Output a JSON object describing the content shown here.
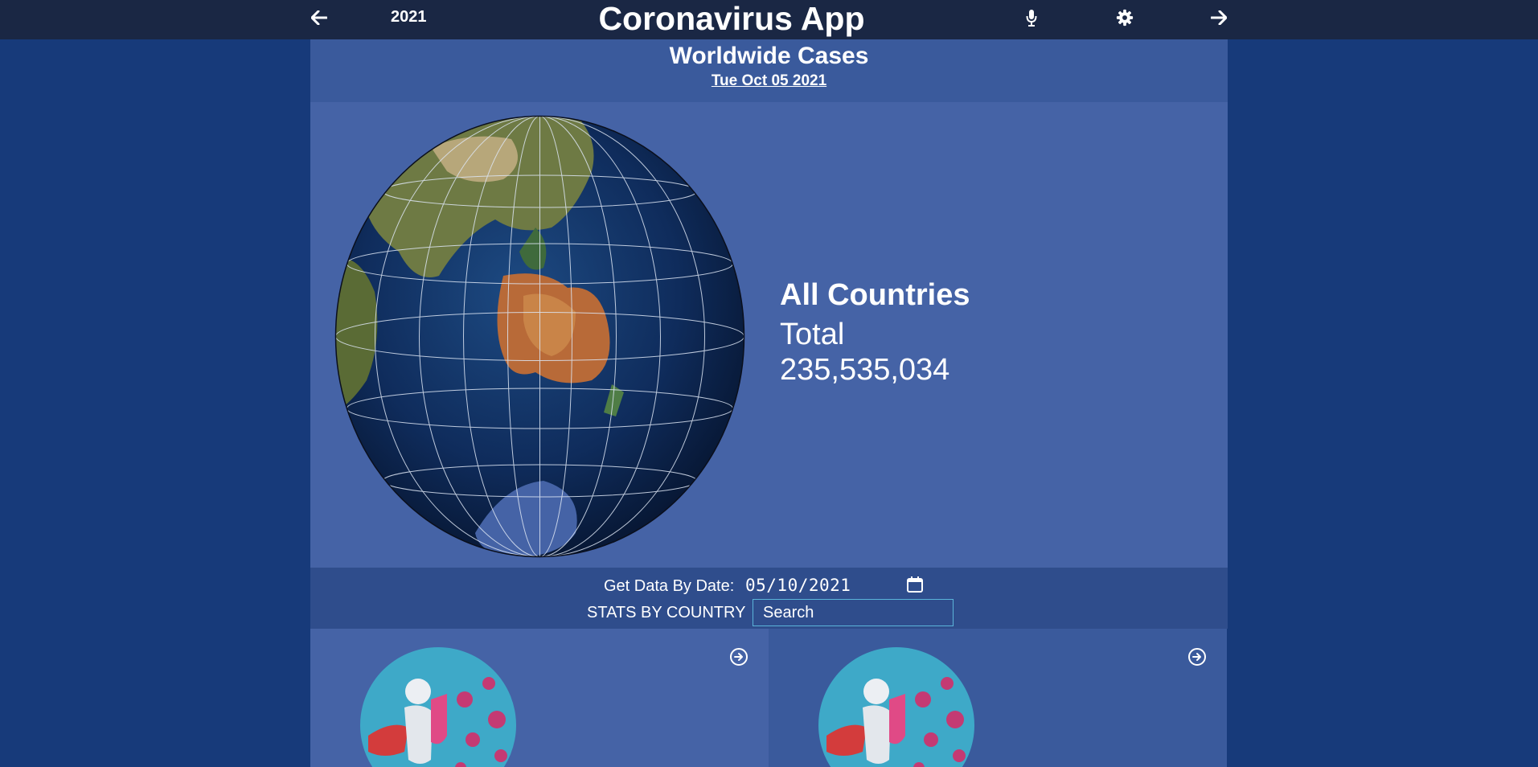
{
  "app": {
    "title": "Coronavirus App",
    "year": "2021",
    "icons": [
      "arrow-left-icon",
      "microphone-icon",
      "gear-icon",
      "arrow-right-icon"
    ]
  },
  "header": {
    "heading": "Worldwide Cases",
    "date": "Tue Oct 05 2021"
  },
  "summary": {
    "region": "All Countries",
    "total_label": "Total",
    "total_value": "235,535,034"
  },
  "controls": {
    "date_label": "Get Data By Date:",
    "date_value": "05/10/2021",
    "stats_label": "STATS BY COUNTRY",
    "search_placeholder": "Search"
  },
  "colors": {
    "page_bg": "#173a7a",
    "topbar_bg": "#1a2744",
    "panel_bg": "#4563a6",
    "panel_dark": "#2f4d8c",
    "search_border": "#5bb4d9"
  }
}
